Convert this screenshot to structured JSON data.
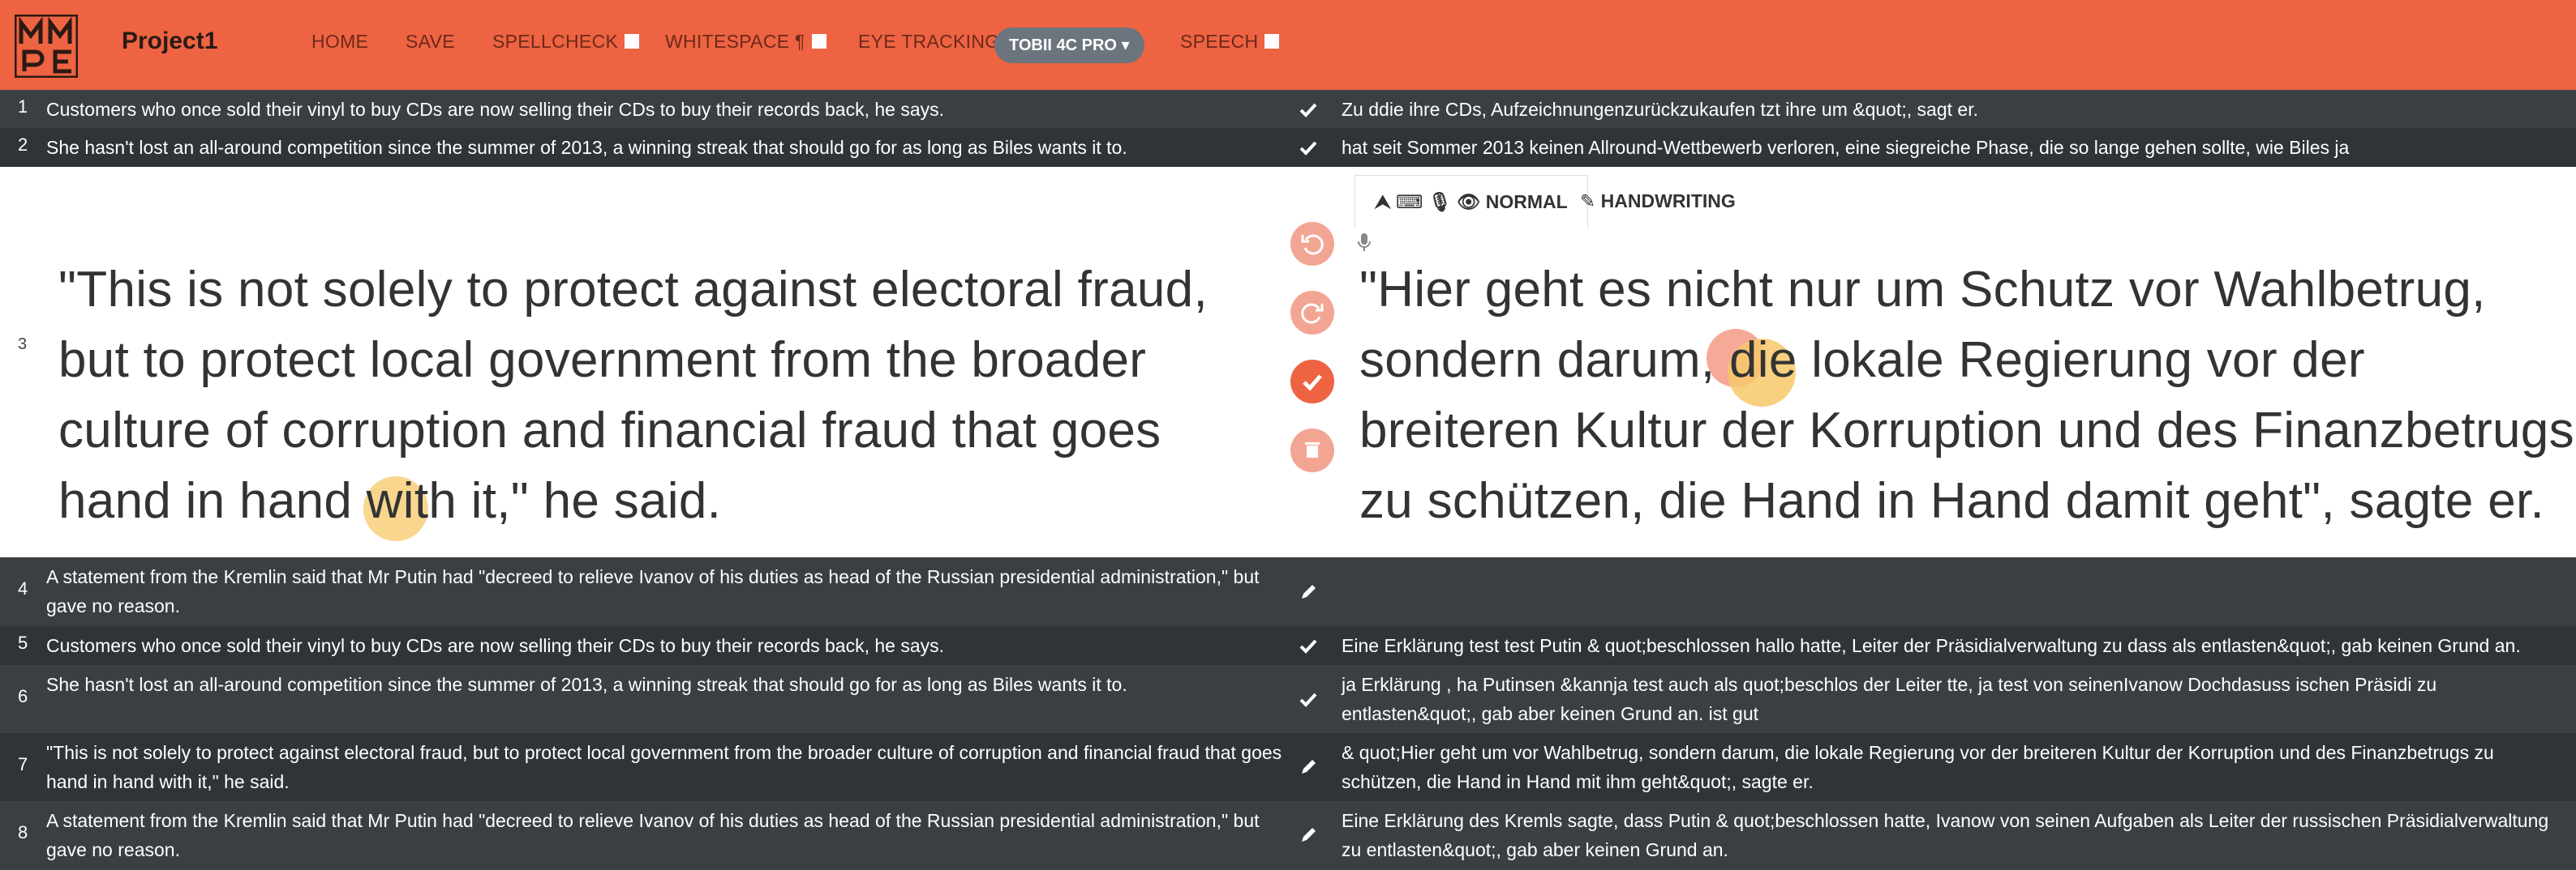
{
  "header": {
    "project": "Project1",
    "nav": {
      "home": "HOME",
      "save": "SAVE",
      "spellcheck": "SPELLCHECK",
      "whitespace": "WHITESPACE ¶",
      "eye_tracking": "EYE TRACKING",
      "tracker": "TOBII 4C PRO",
      "speech": "SPEECH"
    }
  },
  "rows": [
    {
      "num": "1",
      "source": "Customers who once sold their vinyl to buy CDs are now selling their CDs to buy their records back, he says.",
      "target": "Zu ddie ihre CDs, Aufzeichnungenzurückzukaufen tzt ihre um &quot;, sagt er.",
      "icon": "check-icon"
    },
    {
      "num": "2",
      "source": "She hasn't lost an all-around competition since the summer of 2013, a winning streak that should go for as long as Biles wants it to.",
      "target": "hat seit Sommer 2013 keinen Allround-Wettbewerb verloren, eine siegreiche Phase, die so lange gehen sollte, wie Biles ja",
      "icon": "check-icon"
    },
    {
      "num": "4",
      "source": "A statement from the Kremlin said that Mr Putin had \"decreed to relieve Ivanov of his duties as head of the Russian presidential administration,\" but gave no reason.",
      "target": "",
      "icon": "pencil-icon"
    },
    {
      "num": "5",
      "source": "Customers who once sold their vinyl to buy CDs are now selling their CDs to buy their records back, he says.",
      "target": "Eine Erklärung test test Putin & quot;beschlossen hallo hatte, Leiter der Präsidialverwaltung zu dass als entlasten&quot;, gab keinen Grund an.",
      "icon": "check-icon"
    },
    {
      "num": "6",
      "source": "She hasn't lost an all-around competition since the summer of 2013, a winning streak that should go for as long as Biles wants it to.",
      "target": "ja Erklärung , ha Putinsen &kannja test auch als quot;beschlos der Leiter tte, ja test von seinenIvanow Dochdasuss ischen Präsidi zu entlasten&quot;, gab aber keinen Grund an. ist gut",
      "icon": "check-icon"
    },
    {
      "num": "7",
      "source": "\"This is not solely to protect against electoral fraud, but to protect local government from the broader culture of corruption and financial fraud that goes hand in hand with it,\" he said.",
      "target": "& quot;Hier geht um vor Wahlbetrug, sondern darum, die lokale Regierung vor der breiteren Kultur der Korruption und des Finanzbetrugs zu schützen, die Hand in Hand mit ihm geht&quot;, sagte er.",
      "icon": "pencil-icon"
    },
    {
      "num": "8",
      "source": "A statement from the Kremlin said that Mr Putin had \"decreed to relieve Ivanov of his duties as head of the Russian presidential administration,\" but gave no reason.",
      "target": "Eine Erklärung des Kremls sagte, dass Putin & quot;beschlossen hatte, Ivanow von seinen Aufgaben als Leiter der russischen Präsidialverwaltung zu entlasten&quot;, gab aber keinen Grund an.",
      "icon": "pencil-icon"
    }
  ],
  "active": {
    "num": "3",
    "source": "\"This is not solely to protect against electoral fraud, but to protect local government from the broader culture of corruption and financial fraud that goes hand in hand with it,\" he said.",
    "target": "\"Hier geht es nicht nur um Schutz vor Wahlbetrug, sondern darum, die lokale Regierung vor der breiteren  Kultur der Korruption und des Finanzbetrugs zu schützen, die Hand in Hand damit geht\", sagte er.",
    "tab_normal": "NORMAL",
    "tab_handwriting": "HANDWRITING"
  },
  "colors": {
    "accent": "#ee6342",
    "row_bg": "#3a3f44",
    "row_alt": "#2f3438",
    "gaze": "#f7c868",
    "pill": "#6c757d"
  }
}
